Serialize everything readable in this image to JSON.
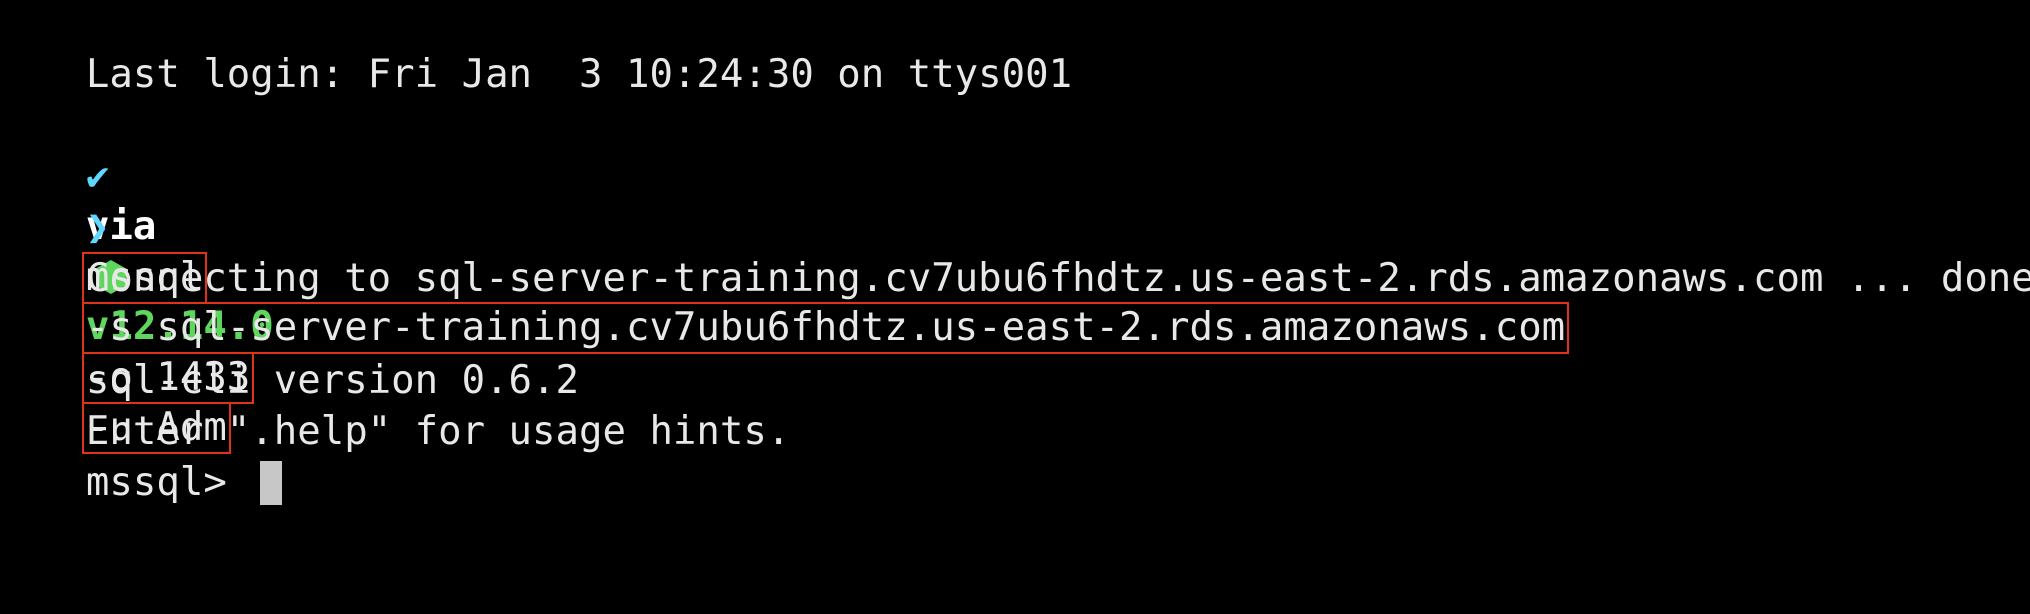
{
  "terminal": {
    "last_login": "Last login: Fri Jan  3 10:24:30 on ttys001",
    "prompt": {
      "arrow": "✔",
      "via": "via",
      "node_icon": "nodejs-hexagon-icon",
      "node_version": "v12.14.0"
    },
    "command": {
      "arrow": "❯",
      "program": "mssql",
      "server_flag": "-s sql-server-training.cv7ubu6fhdtz.us-east-2.rds.amazonaws.com",
      "port_flag": "-o 1433",
      "user_flag": "-u Adm"
    },
    "connecting": "Connecting to sql-server-training.cv7ubu6fhdtz.us-east-2.rds.amazonaws.com ... done",
    "version": "sql-cli version 0.6.2",
    "help": "Enter \".help\" for usage hints.",
    "repl_prompt": "mssql> "
  },
  "colors": {
    "background": "#000000",
    "text": "#e8e8e8",
    "node_green": "#5fd75f",
    "highlight_box": "#e0321b"
  }
}
